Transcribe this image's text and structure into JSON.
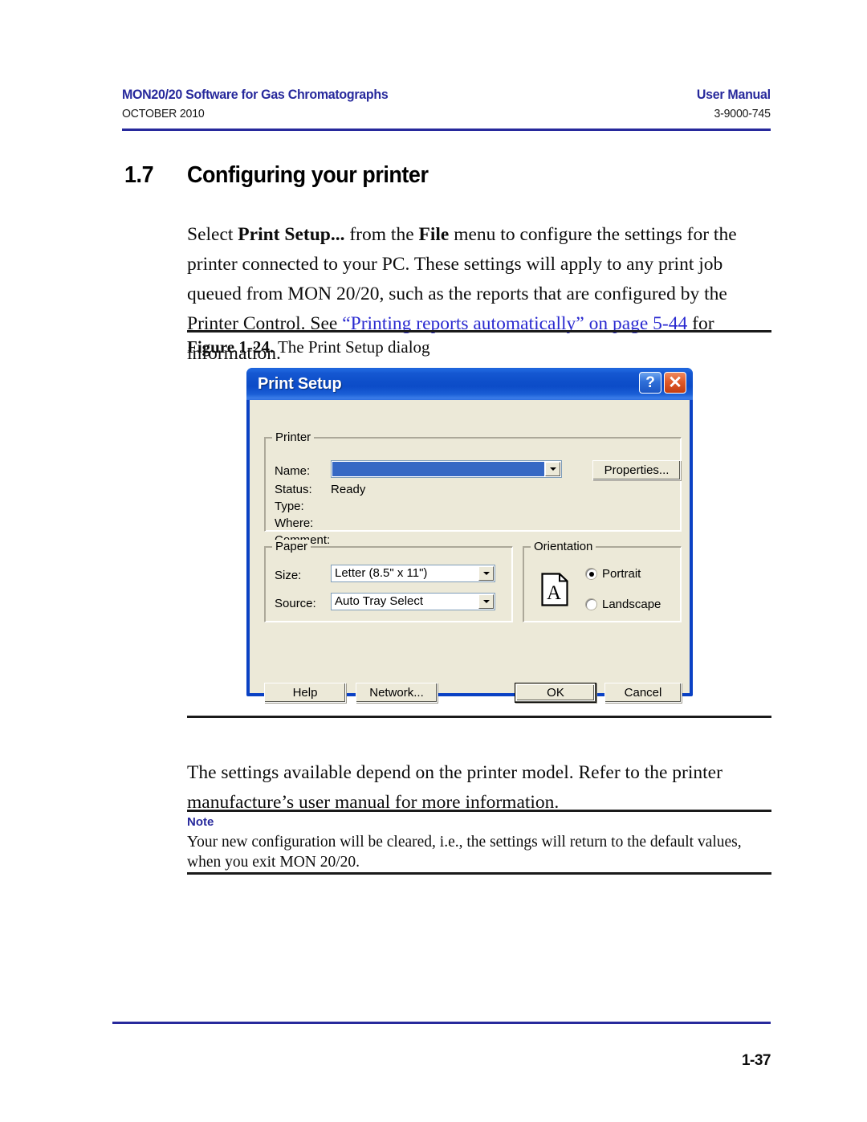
{
  "header": {
    "left_title": "MON20/20 Software for Gas Chromatographs",
    "left_sub": "OCTOBER 2010",
    "right_title": "User Manual",
    "right_sub": "3-9000-745",
    "accent_color": "#27299c"
  },
  "section": {
    "number": "1.7",
    "title": "Configuring your printer"
  },
  "paragraphs": {
    "intro_1": "Select ",
    "intro_bold_1": "Print Setup...",
    "intro_2": " from the ",
    "intro_bold_2": "File",
    "intro_3": " menu to configure the settings for the printer connected to your PC. These settings will apply to any print job queued from MON 20/20, such as the reports that are configured by the Printer Control.  See ",
    "intro_link": "“Printing reports automatically” on page 5-44",
    "intro_4": " for information.",
    "after_figure": "The settings available depend on the printer model. Refer to the printer manufacture’s user manual for more information."
  },
  "figure": {
    "label": "Figure 1-24.",
    "caption": " The Print Setup dialog"
  },
  "note": {
    "title": "Note",
    "body": "Your new configuration will be cleared, i.e., the settings will return to the default values, when you exit MON 20/20."
  },
  "footer": {
    "page_number": "1-37"
  },
  "dialog": {
    "title": "Print Setup",
    "titlebar_color": "#0e4fca",
    "face_color": "#ece9d8",
    "help_button": "?",
    "close_button": "✕",
    "printer_group": {
      "legend": "Printer",
      "name_label": "Name:",
      "name_value": "",
      "name_highlight_color": "#3668c4",
      "properties_button": "Properties...",
      "status_label": "Status:",
      "status_value": "Ready",
      "type_label": "Type:",
      "type_value": "",
      "where_label": "Where:",
      "where_value": "",
      "comment_label": "Comment:",
      "comment_value": ""
    },
    "paper_group": {
      "legend": "Paper",
      "size_label": "Size:",
      "size_value": "Letter (8.5\" x 11\")",
      "source_label": "Source:",
      "source_value": "Auto Tray Select"
    },
    "orientation_group": {
      "legend": "Orientation",
      "portrait_label": "Portrait",
      "portrait_selected": true,
      "landscape_label": "Landscape",
      "landscape_selected": false,
      "preview_letter": "A"
    },
    "buttons": {
      "help": "Help",
      "network": "Network...",
      "ok": "OK",
      "cancel": "Cancel"
    }
  }
}
